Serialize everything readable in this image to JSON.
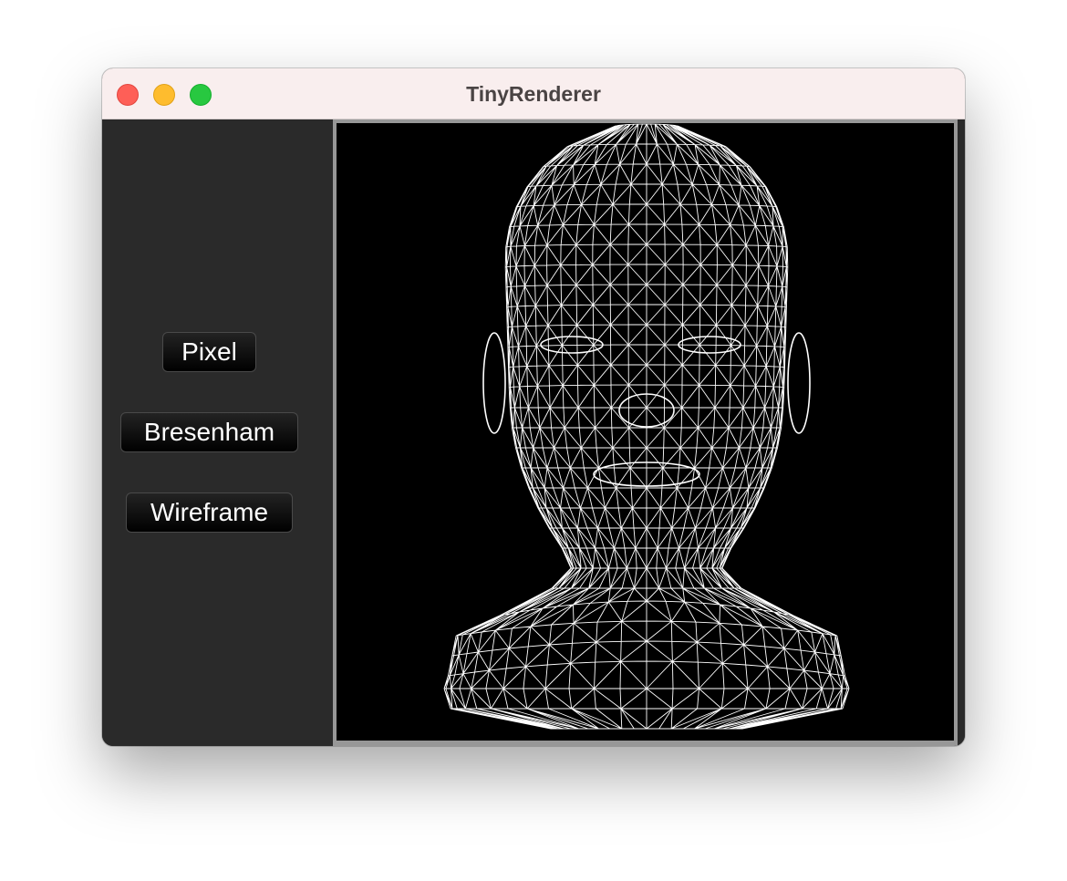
{
  "window": {
    "title": "TinyRenderer"
  },
  "sidebar": {
    "buttons": {
      "pixel": "Pixel",
      "bresenham": "Bresenham",
      "wireframe": "Wireframe"
    }
  },
  "canvas": {
    "content": "wireframe-head-render",
    "background": "#000000",
    "line_color": "#ffffff"
  },
  "colors": {
    "titlebar": "#f9eeee",
    "sidebar": "#2a2a2a",
    "close": "#fe5f57",
    "minimize": "#febc2e",
    "maximize": "#28c840"
  }
}
